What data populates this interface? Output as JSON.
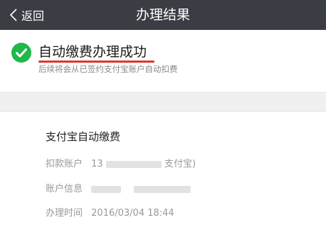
{
  "navbar": {
    "back_label": "返回",
    "title": "办理结果"
  },
  "status": {
    "icon": "check-circle-icon",
    "title": "自动缴费办理成功",
    "subtitle": "后续将会从已签约支付宝账户自动扣费",
    "success_color": "#1fb84a",
    "underline_color": "#e53128"
  },
  "detail": {
    "title": "支付宝自动缴费",
    "rows": [
      {
        "label": "扣款账户",
        "value_prefix": "13",
        "value_suffix": "支付宝)"
      },
      {
        "label": "账户信息"
      },
      {
        "label": "办理时间",
        "value": "2016/03/04 18:44"
      }
    ]
  },
  "colors": {
    "navbar_bg": "#3a3d43",
    "section_gap_bg": "#f0f0f0"
  }
}
